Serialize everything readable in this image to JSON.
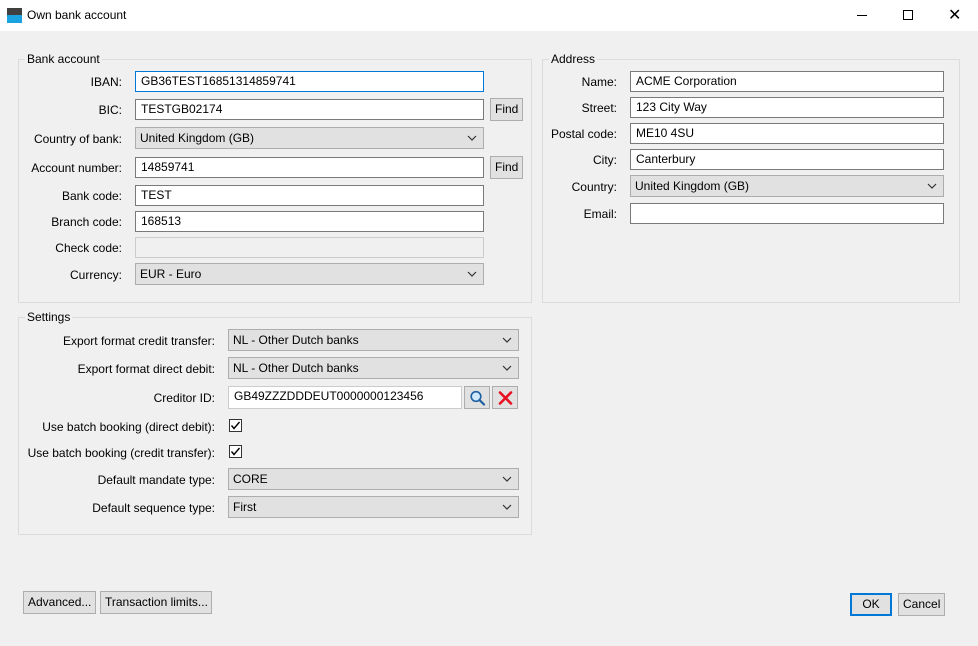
{
  "window": {
    "title": "Own bank account"
  },
  "bank_account": {
    "legend": "Bank account",
    "iban_label": "IBAN:",
    "iban_value": "GB36TEST16851314859741",
    "bic_label": "BIC:",
    "bic_value": "TESTGB02174",
    "find_label": "Find",
    "country_label": "Country of bank:",
    "country_value": "United Kingdom (GB)",
    "account_number_label": "Account number:",
    "account_number_value": "14859741",
    "bank_code_label": "Bank code:",
    "bank_code_value": "TEST",
    "branch_code_label": "Branch code:",
    "branch_code_value": "168513",
    "check_code_label": "Check code:",
    "check_code_value": "",
    "currency_label": "Currency:",
    "currency_value": "EUR - Euro"
  },
  "address": {
    "legend": "Address",
    "name_label": "Name:",
    "name_value": "ACME Corporation",
    "street_label": "Street:",
    "street_value": "123 City Way",
    "postal_label": "Postal code:",
    "postal_value": "ME10 4SU",
    "city_label": "City:",
    "city_value": "Canterbury",
    "country_label": "Country:",
    "country_value": "United Kingdom (GB)",
    "email_label": "Email:",
    "email_value": ""
  },
  "settings": {
    "legend": "Settings",
    "export_ct_label": "Export format credit transfer:",
    "export_ct_value": "NL - Other Dutch banks",
    "export_dd_label": "Export format direct debit:",
    "export_dd_value": "NL - Other Dutch banks",
    "creditor_label": "Creditor ID:",
    "creditor_value": "GB49ZZZDDDEUT0000000123456",
    "batch_dd_label": "Use batch booking (direct debit):",
    "batch_dd_checked": true,
    "batch_ct_label": "Use batch booking (credit transfer):",
    "batch_ct_checked": true,
    "mandate_label": "Default mandate type:",
    "mandate_value": "CORE",
    "sequence_label": "Default sequence type:",
    "sequence_value": "First"
  },
  "footer": {
    "advanced_label": "Advanced...",
    "limits_label": "Transaction limits...",
    "ok_label": "OK",
    "cancel_label": "Cancel"
  },
  "icons": {
    "app": "app-icon",
    "search": "magnifier-icon",
    "clear": "red-x-icon",
    "dropdown": "chevron-down-icon",
    "check": "checkmark-icon"
  },
  "colors": {
    "accent": "#0078d7",
    "clear_red": "#e81123",
    "app_icon_blue": "#1aa3e0"
  }
}
